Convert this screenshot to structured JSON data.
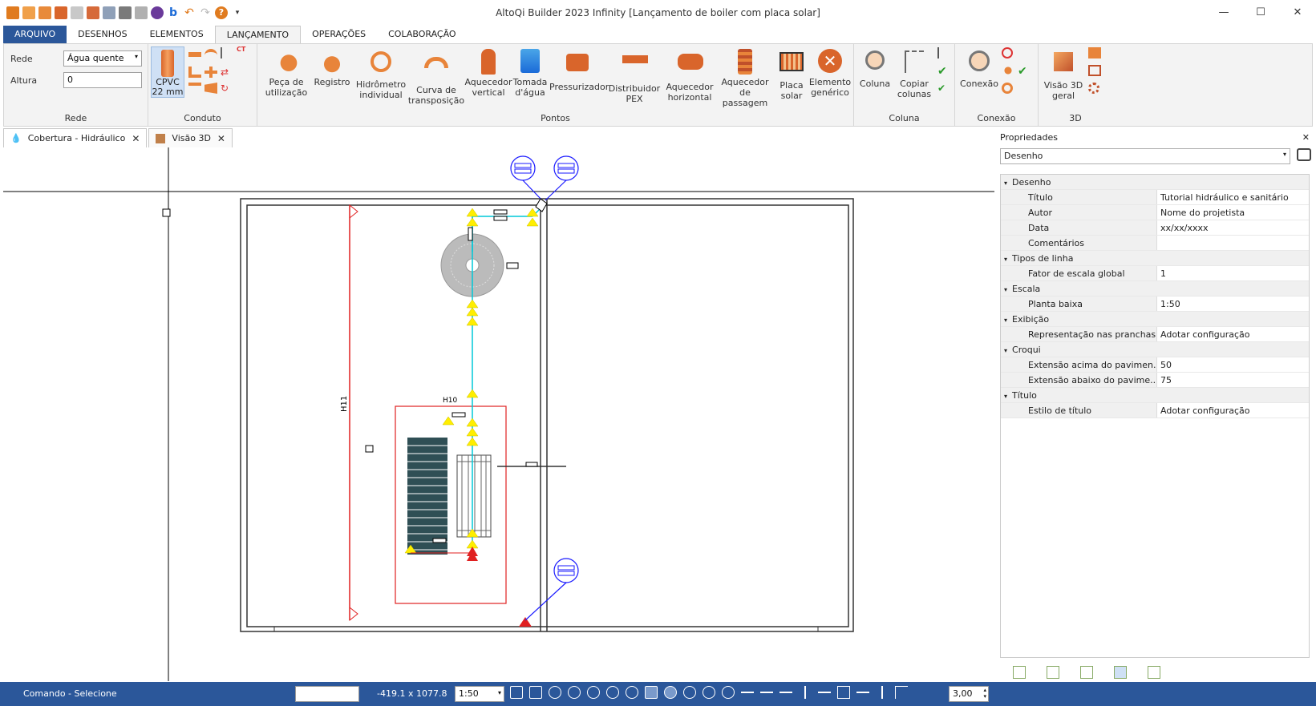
{
  "window": {
    "title": "AltoQi Builder 2023 Infinity [Lançamento de boiler com placa solar]",
    "minimize": "—",
    "maximize": "☐",
    "close": "✕"
  },
  "ribbon_tabs": [
    "ARQUIVO",
    "DESENHOS",
    "ELEMENTOS",
    "LANÇAMENTO",
    "OPERAÇÕES",
    "COLABORAÇÃO"
  ],
  "rede_group": {
    "label": "Rede",
    "rede_label": "Rede",
    "rede_value": "Água quente",
    "altura_label": "Altura",
    "altura_value": "0"
  },
  "conduto_group": {
    "label": "Conduto",
    "cpvc_line1": "CPVC",
    "cpvc_line2": "22 mm"
  },
  "pontos_group": {
    "label": "Pontos",
    "buttons": [
      {
        "line1": "Peça de",
        "line2": "utilização"
      },
      {
        "line1": "Registro",
        "line2": ""
      },
      {
        "line1": "Hidrômetro",
        "line2": "individual"
      },
      {
        "line1": "Curva de",
        "line2": "transposição"
      },
      {
        "line1": "Aquecedor",
        "line2": "vertical"
      },
      {
        "line1": "Tomada",
        "line2": "d'água"
      },
      {
        "line1": "Pressurizador",
        "line2": ""
      },
      {
        "line1": "Distribuidor",
        "line2": "PEX"
      },
      {
        "line1": "Aquecedor",
        "line2": "horizontal"
      },
      {
        "line1": "Aquecedor",
        "line2": "de passagem"
      },
      {
        "line1": "Placa",
        "line2": "solar"
      },
      {
        "line1": "Elemento",
        "line2": "genérico"
      }
    ]
  },
  "coluna_group": {
    "label": "Coluna",
    "buttons": [
      {
        "line1": "Coluna",
        "line2": ""
      },
      {
        "line1": "Copiar",
        "line2": "colunas"
      }
    ]
  },
  "conexao_group": {
    "label": "Conexão",
    "button": "Conexão"
  },
  "group3d": {
    "label": "3D",
    "line1": "Visão 3D",
    "line2": "geral"
  },
  "doc_tabs": [
    {
      "label": "Cobertura - Hidráulico",
      "close": "✕"
    },
    {
      "label": "Visão 3D",
      "close": "✕"
    }
  ],
  "drawing": {
    "label_h10": "H10",
    "label_h11": "H11"
  },
  "properties": {
    "title": "Propriedades",
    "close": "✕",
    "selector": "Desenho",
    "rows": [
      {
        "type": "cat",
        "label": "Desenho"
      },
      {
        "type": "prop",
        "key": "Título",
        "value": "Tutorial hidráulico e sanitário"
      },
      {
        "type": "prop",
        "key": "Autor",
        "value": "Nome do projetista"
      },
      {
        "type": "prop",
        "key": "Data",
        "value": "xx/xx/xxxx"
      },
      {
        "type": "prop",
        "key": "Comentários",
        "value": ""
      },
      {
        "type": "cat",
        "label": "Tipos de linha"
      },
      {
        "type": "prop",
        "key": "Fator de escala global",
        "value": "1"
      },
      {
        "type": "cat",
        "label": "Escala"
      },
      {
        "type": "prop",
        "key": "Planta baixa",
        "value": "1:50"
      },
      {
        "type": "cat",
        "label": "Exibição"
      },
      {
        "type": "prop",
        "key": "Representação nas pranchas",
        "value": "Adotar configuração"
      },
      {
        "type": "cat",
        "label": "Croqui"
      },
      {
        "type": "prop",
        "key": "Extensão acima do pavimen...",
        "value": "50"
      },
      {
        "type": "prop",
        "key": "Extensão abaixo do pavime...",
        "value": "75"
      },
      {
        "type": "cat",
        "label": "Título"
      },
      {
        "type": "prop",
        "key": "Estilo de título",
        "value": "Adotar configuração"
      }
    ]
  },
  "status": {
    "command": "Comando - Selecione",
    "command_input": "",
    "coords": "-419.1 x 1077.8",
    "scale": "1:50",
    "thickness": "3,00"
  },
  "colors": {
    "accent": "#2b579a",
    "pipe": "#00c8d8",
    "marker": "#ffee00",
    "red": "#e02020",
    "annotation": "#1a1aff"
  }
}
